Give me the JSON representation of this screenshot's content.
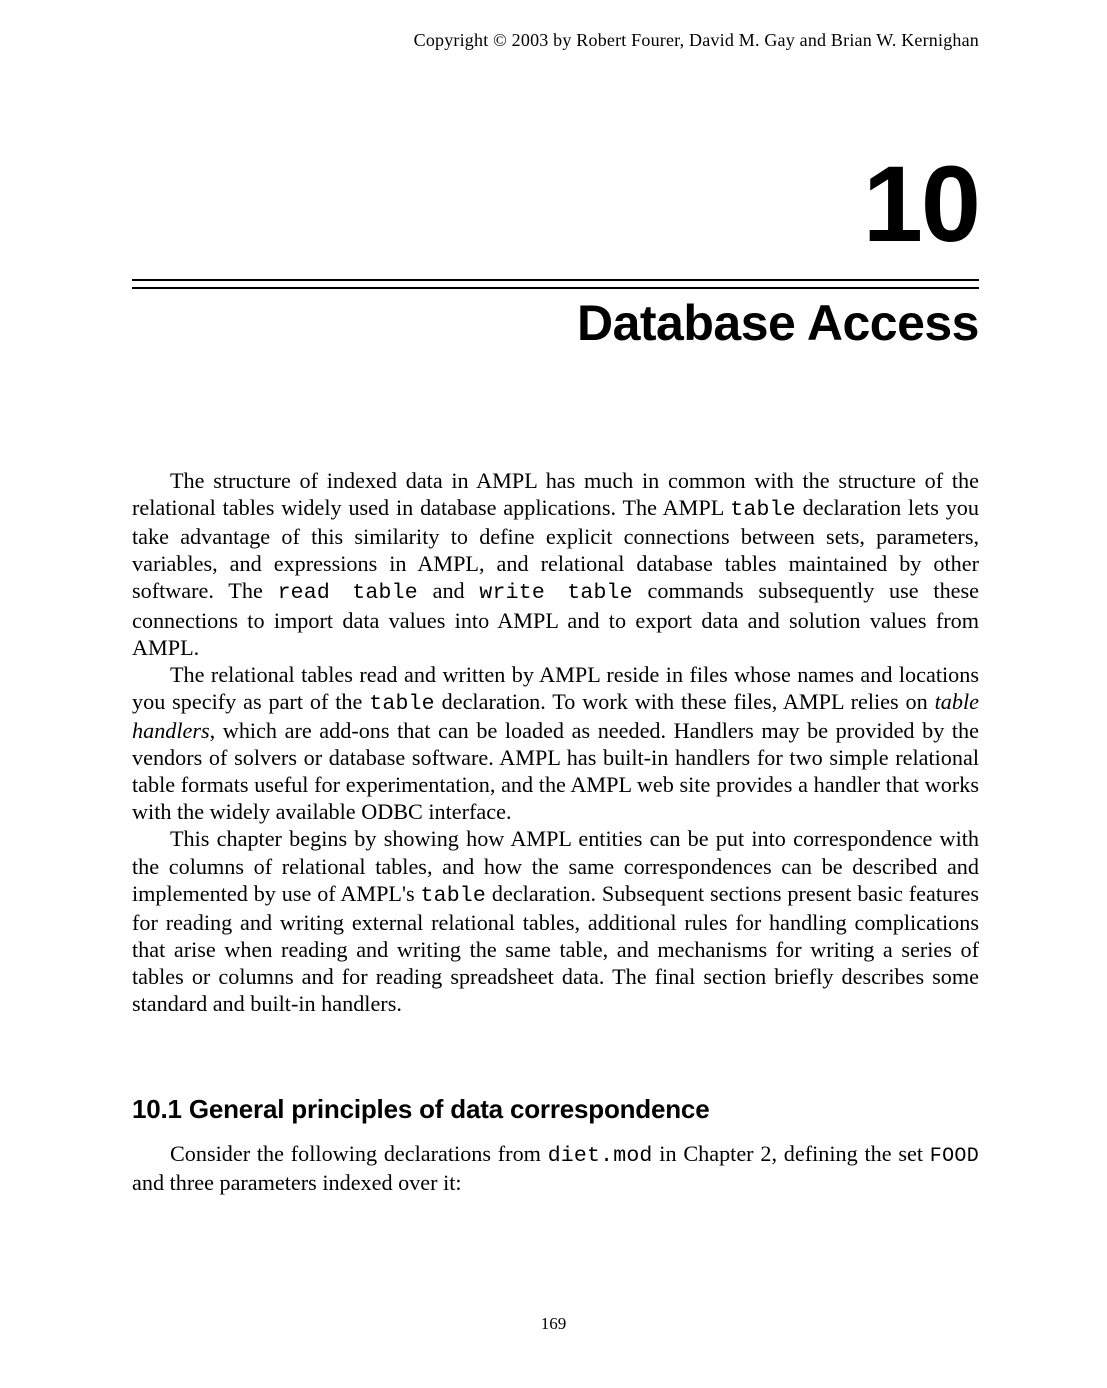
{
  "header": {
    "copyright": "Copyright © 2003 by Robert Fourer, David M. Gay and Brian W. Kernighan"
  },
  "chapter": {
    "number": "10",
    "title": "Database Access"
  },
  "body": {
    "p1a": "The structure of indexed data in AMPL has much in common with the structure of the relational tables widely used in database applications.  The AMPL ",
    "p1_code1": "table",
    "p1b": " declaration lets you take advantage of this similarity to define explicit connections between sets, parameters, variables, and expressions in AMPL, and relational database tables maintained by other software.  The ",
    "p1_code2": "read table",
    "p1c": " and ",
    "p1_code3": "write table",
    "p1d": " commands subsequently use these connections to import data values into AMPL and to export data and solution values from AMPL.",
    "p2a": "The relational tables read and written by AMPL reside in files whose names and locations you specify as part of the ",
    "p2_code1": "table",
    "p2b": " declaration.  To work with these files, AMPL relies on ",
    "p2_em": "table handlers",
    "p2c": ", which are add-ons that can be loaded as needed.  Handlers may be provided by the vendors of solvers or database software.  AMPL has built-in handlers for two simple relational table formats useful for experimentation, and the AMPL web site provides a handler that works with the widely available ODBC interface.",
    "p3a": "This chapter begins by showing how AMPL entities can be put into correspondence with the columns of relational tables, and how the same correspondences can be described and implemented by use of AMPL's ",
    "p3_code1": "table",
    "p3b": " declaration.  Subsequent sections present basic features for reading and writing external relational tables, additional rules for handling complications that arise when reading and writing the same table, and mechanisms for writing a series of tables or columns and for reading spreadsheet data.  The final section briefly describes some standard and built-in handlers."
  },
  "section": {
    "heading": "10.1  General principles of data correspondence",
    "p1a": "Consider the following declarations from ",
    "p1_code1": "diet.mod",
    "p1b": " in Chapter 2, defining the set ",
    "p1_code2": "FOOD",
    "p1c": " and three parameters indexed over it:"
  },
  "footer": {
    "pagenum": "169"
  }
}
